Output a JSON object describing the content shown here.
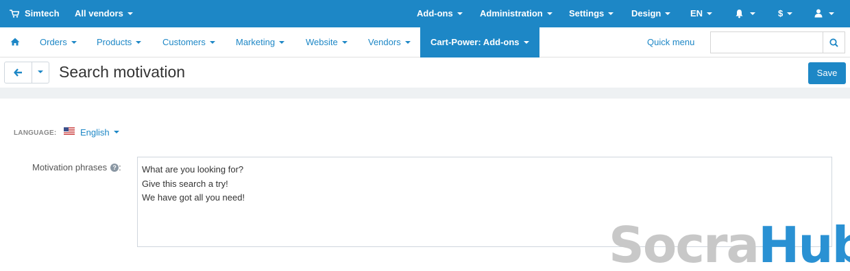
{
  "topbar": {
    "store_name": "Simtech",
    "vendor_select": "All vendors",
    "menus": [
      "Add-ons",
      "Administration",
      "Settings",
      "Design",
      "EN",
      "$"
    ]
  },
  "navbar": {
    "items": [
      "Orders",
      "Products",
      "Customers",
      "Marketing",
      "Website",
      "Vendors",
      "Cart-Power: Add-ons"
    ],
    "quick_menu": "Quick menu",
    "search_placeholder": ""
  },
  "titlebar": {
    "title": "Search motivation",
    "save_label": "Save"
  },
  "content": {
    "language_label": "LANGUAGE:",
    "language_value": "English",
    "field_label": "Motivation phrases",
    "field_colon": ":",
    "phrases": [
      "What are you looking for?",
      "Give this search a try!",
      "We have got all you need!"
    ]
  },
  "watermark": {
    "part1": "Socra",
    "part2": "Hub"
  },
  "colors": {
    "primary": "#1d87c6",
    "background": "#ffffff",
    "divider": "#eef1f3"
  }
}
